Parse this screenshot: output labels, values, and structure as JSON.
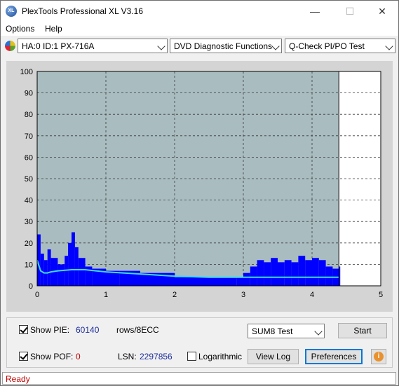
{
  "window": {
    "title": "PlexTools Professional XL V3.16",
    "app_icon_text": "XL",
    "minimize_glyph": "—",
    "maximize_glyph": "☐",
    "close_glyph": "✕"
  },
  "menu": {
    "items": [
      "Options",
      "Help"
    ]
  },
  "toolbar": {
    "drive": "HA:0 ID:1  PX-716A",
    "function": "DVD Diagnostic Functions",
    "test": "Q-Check PI/PO Test"
  },
  "chart_data": {
    "type": "area",
    "xlim": [
      0,
      5
    ],
    "ylim": [
      0,
      100
    ],
    "x_ticks": [
      "0",
      "1",
      "2",
      "3",
      "4",
      "5"
    ],
    "y_ticks": [
      "0",
      "10",
      "20",
      "30",
      "40",
      "50",
      "60",
      "70",
      "80",
      "90",
      "100"
    ],
    "grid": true,
    "scan_end_x": 4.39,
    "series": [
      {
        "kind": "bars",
        "color": "#0000ff",
        "x": [
          0.0,
          0.05,
          0.1,
          0.15,
          0.2,
          0.3,
          0.4,
          0.45,
          0.5,
          0.55,
          0.6,
          0.7,
          0.8,
          1.0,
          1.2,
          1.5,
          2.0,
          2.5,
          2.9,
          3.0,
          3.1,
          3.2,
          3.3,
          3.4,
          3.5,
          3.6,
          3.7,
          3.8,
          3.9,
          4.0,
          4.1,
          4.2,
          4.3,
          4.39
        ],
        "values": [
          24,
          15,
          12,
          17,
          13,
          10,
          14,
          20,
          25,
          18,
          13,
          9,
          8,
          7,
          7,
          6,
          4,
          4,
          4,
          6,
          9,
          12,
          11,
          13,
          11,
          12,
          11,
          14,
          12,
          13,
          12,
          9,
          8,
          9
        ]
      },
      {
        "kind": "line",
        "color": "#3fdcec",
        "x": [
          0.0,
          0.05,
          0.1,
          0.15,
          0.2,
          0.3,
          0.5,
          0.7,
          1.0,
          1.5,
          2.0,
          2.5,
          3.0,
          3.5,
          4.0,
          4.39
        ],
        "values": [
          12,
          7,
          6,
          6,
          6.5,
          7,
          7.5,
          7.5,
          6.5,
          5.5,
          4.5,
          4,
          4,
          4,
          4,
          4
        ]
      }
    ]
  },
  "controls": {
    "show_pie_label": "Show PIE:",
    "pie_value": "60140",
    "rows_label": "rows/8ECC",
    "test_mode": "SUM8 Test",
    "start_label": "Start",
    "show_pof_label": "Show POF:",
    "pof_value": "0",
    "lsn_label": "LSN:",
    "lsn_value": "2297856",
    "log_label": "Logarithmic",
    "view_log_label": "View Log",
    "preferences_label": "Preferences",
    "info_glyph": "i"
  },
  "status": {
    "text": "Ready"
  }
}
